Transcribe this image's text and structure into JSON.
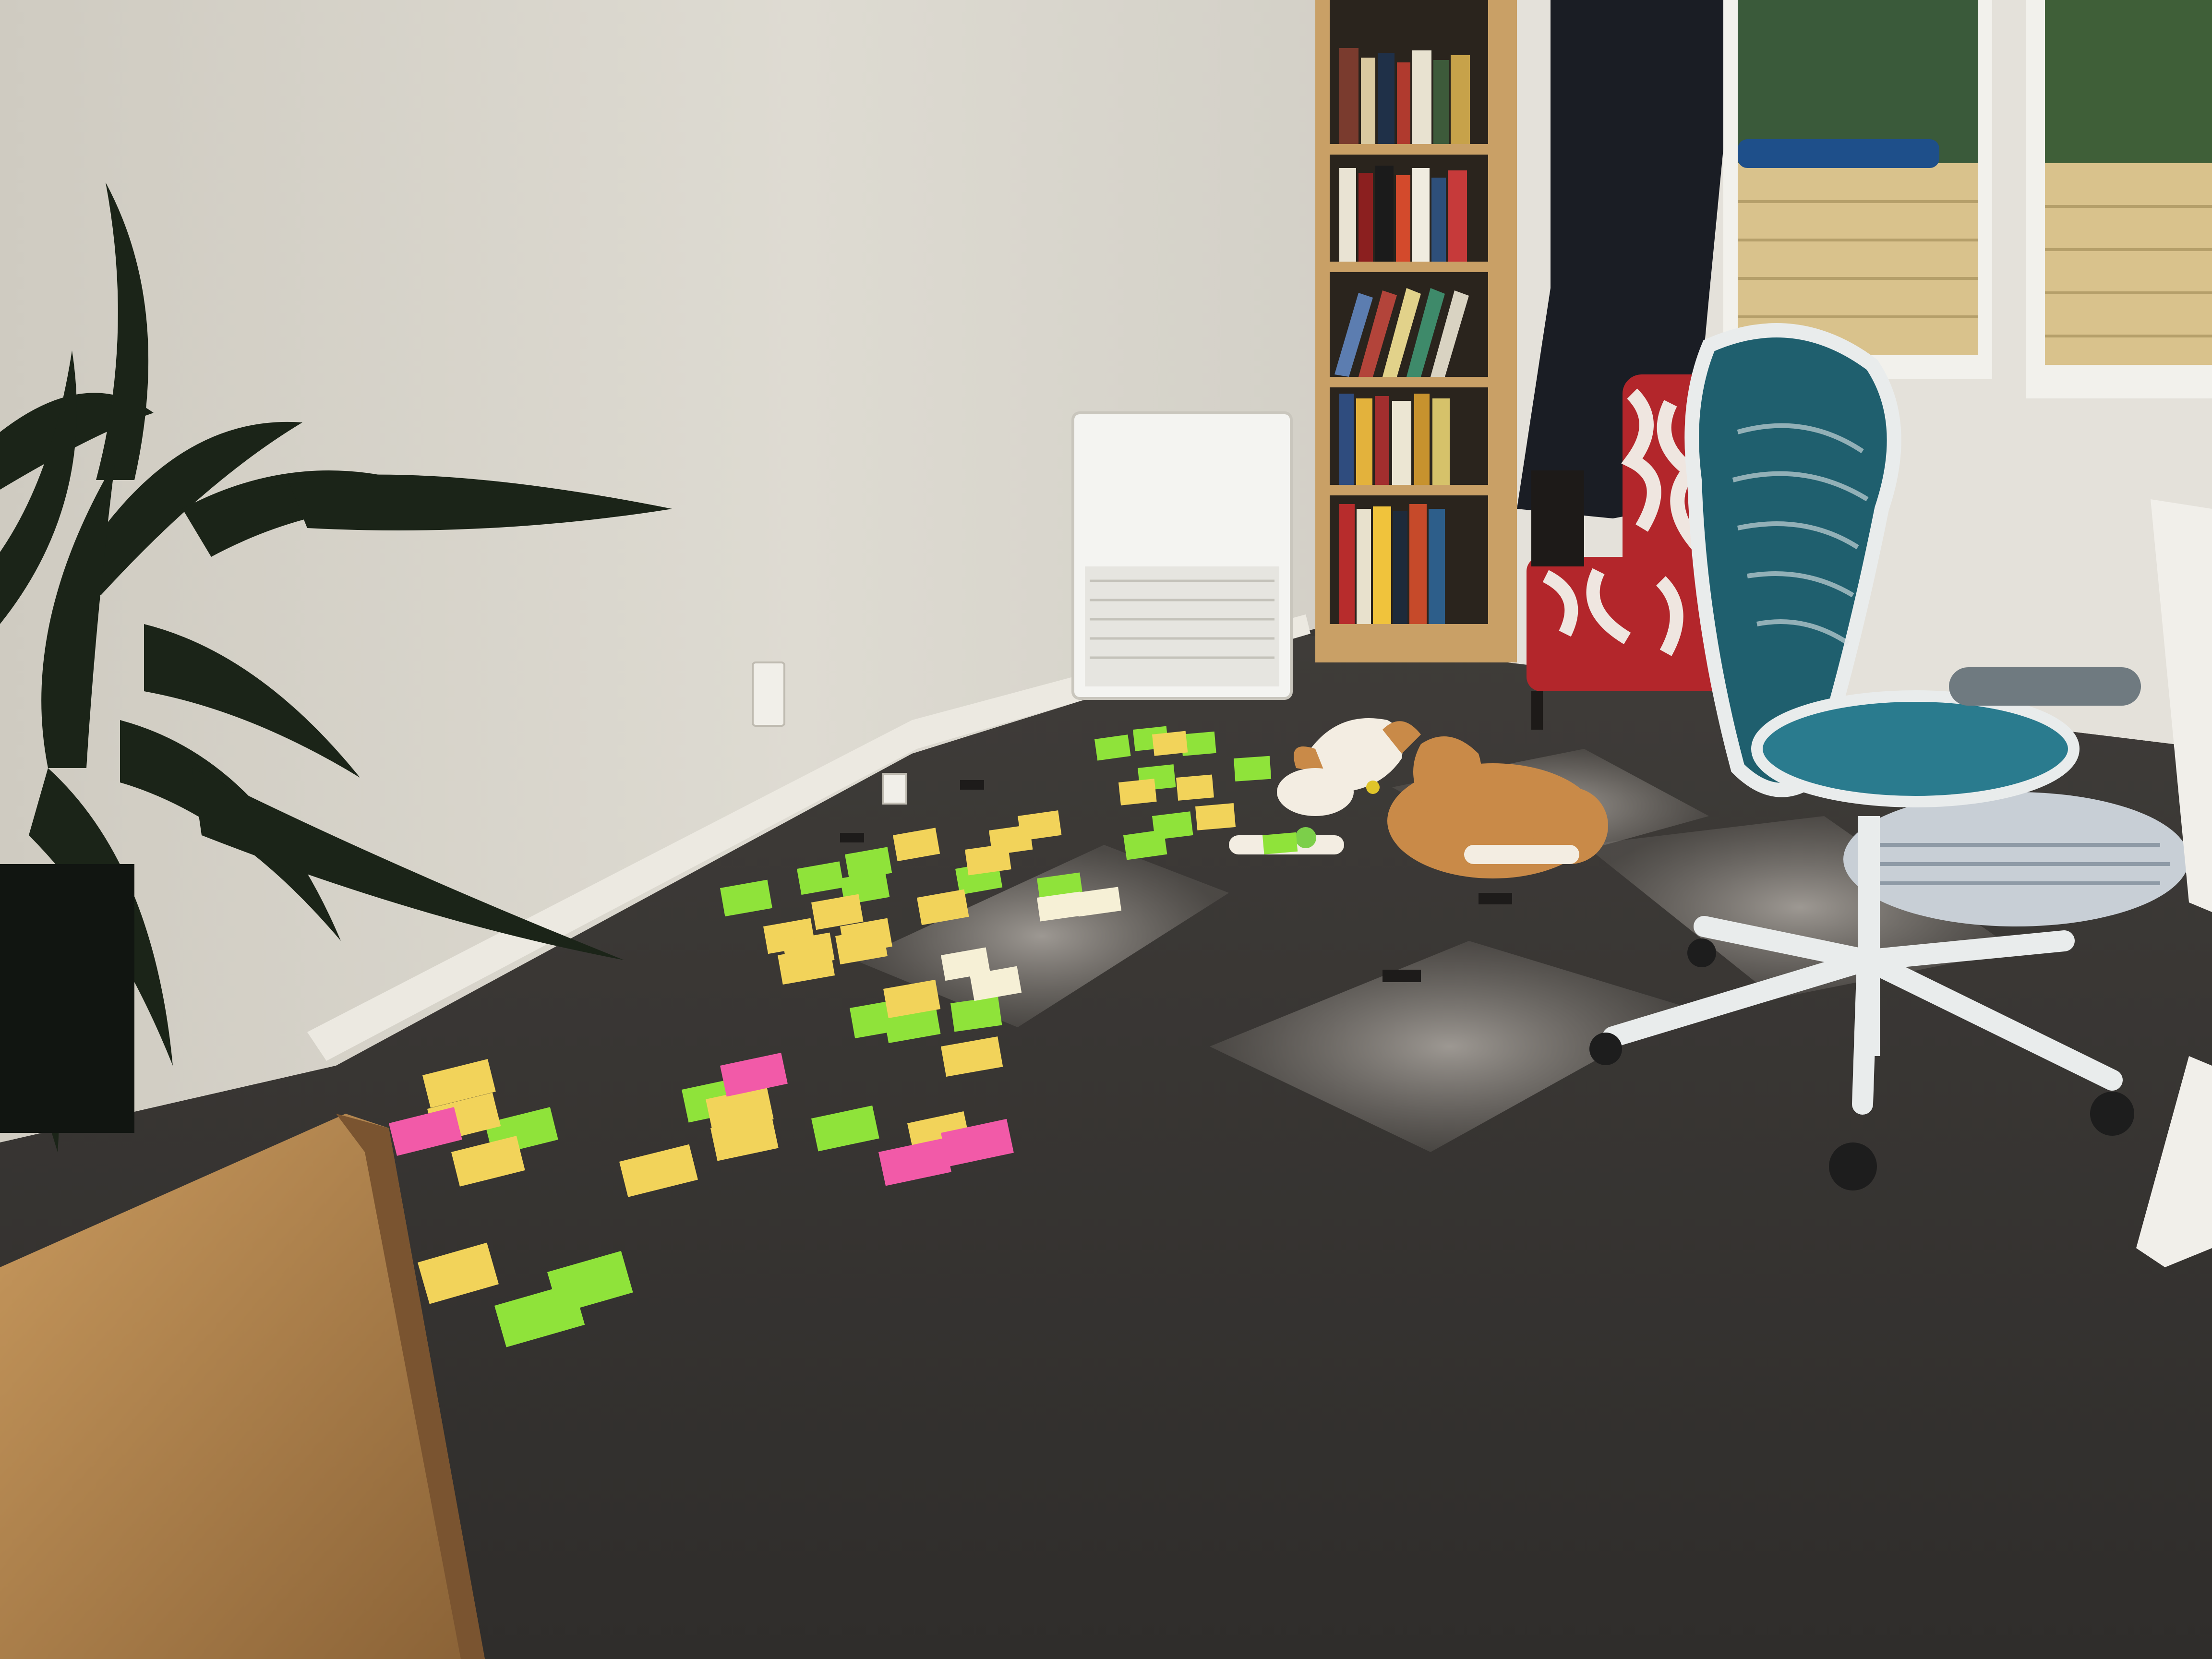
{
  "scene": {
    "kind": "photo",
    "objects": [
      "wall",
      "carpet-floor",
      "skirting-board",
      "air-conditioner",
      "wall-outlet",
      "bookshelf",
      "curtain",
      "window",
      "armchair",
      "office-chair",
      "dog",
      "dog-bed",
      "sticky-notes",
      "potted-plant",
      "wooden-cabinet",
      "desk-edge"
    ]
  },
  "colors": {
    "wall": "#d9d6cc",
    "wall_shadow": "#b9b5aa",
    "carpet": "#3b3836",
    "carpet_light": "#8f8a84",
    "bookshelf_wood": "#c9a066",
    "curtain": "#1a1d24",
    "window_frame": "#f2f1ec",
    "fence": "#d9c28c",
    "armchair_red": "#b3262b",
    "armchair_white": "#efe6e0",
    "chair_mesh": "#1f5f6e",
    "chair_frame": "#e9ecec",
    "dog_coat": "#c98a48",
    "dog_white": "#f3ede2",
    "dog_bed": "#c8cfd6",
    "plant_leaf": "#1b2418",
    "cabinet_wood": "#b98a52",
    "note_yellow": "#f2d35a",
    "note_green": "#8fe33a",
    "note_pink": "#f25aa8",
    "note_pale": "#f6f0d6"
  },
  "sticky_notes": {
    "count": 62,
    "colors": [
      "yellow",
      "green",
      "pink",
      "pale"
    ]
  }
}
